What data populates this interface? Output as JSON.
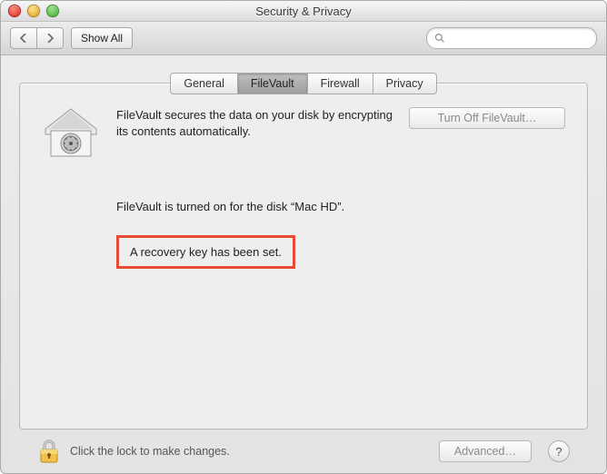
{
  "window": {
    "title": "Security & Privacy"
  },
  "toolbar": {
    "show_all_label": "Show All",
    "search_placeholder": ""
  },
  "tabs": [
    {
      "label": "General",
      "active": false
    },
    {
      "label": "FileVault",
      "active": true
    },
    {
      "label": "Firewall",
      "active": false
    },
    {
      "label": "Privacy",
      "active": false
    }
  ],
  "main": {
    "description": "FileVault secures the data on your disk by encrypting its contents automatically.",
    "turn_off_label": "Turn Off FileVault…",
    "status_text": "FileVault is turned on for the disk “Mac HD”.",
    "recovery_text": "A recovery key has been set.",
    "highlight_color": "#e84b33"
  },
  "footer": {
    "lock_text": "Click the lock to make changes.",
    "advanced_label": "Advanced…",
    "help_label": "?"
  }
}
